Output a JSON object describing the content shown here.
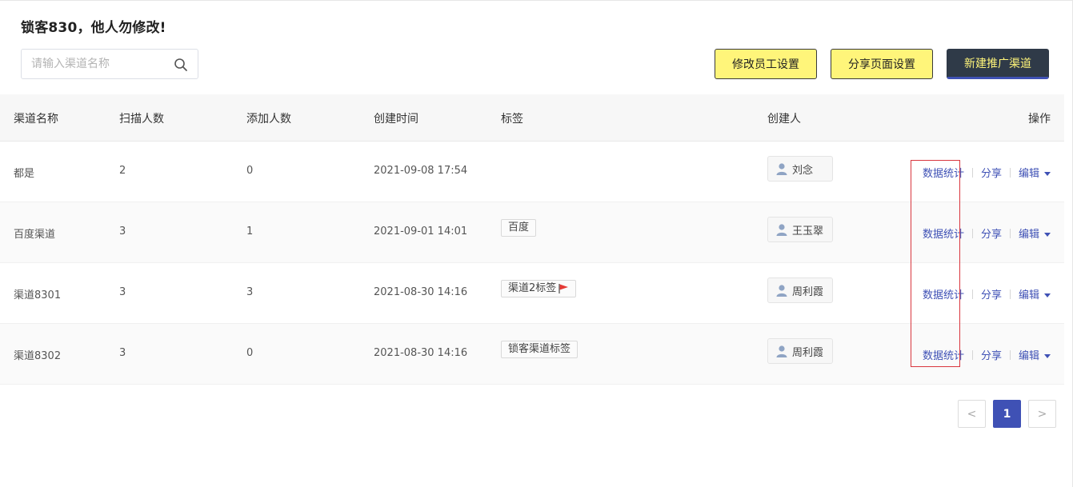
{
  "header": {
    "title": "锁客830，他人勿修改!",
    "search_placeholder": "请输入渠道名称",
    "buttons": {
      "staff_settings": "修改员工设置",
      "share_settings": "分享页面设置",
      "new_channel": "新建推广渠道"
    }
  },
  "table": {
    "columns": {
      "name": "渠道名称",
      "scan": "扫描人数",
      "add": "添加人数",
      "time": "创建时间",
      "tag": "标签",
      "creator": "创建人",
      "ops": "操作"
    },
    "ops_labels": {
      "stats": "数据统计",
      "share": "分享",
      "edit": "编辑"
    },
    "rows": [
      {
        "name": "都是",
        "scan": "2",
        "add": "0",
        "time": "2021-09-08 17:54",
        "tag": "",
        "creator": "刘念"
      },
      {
        "name": "百度渠道",
        "scan": "3",
        "add": "1",
        "time": "2021-09-01 14:01",
        "tag": "百度",
        "creator": "王玉翠"
      },
      {
        "name": "渠道8301",
        "scan": "3",
        "add": "3",
        "time": "2021-08-30 14:16",
        "tag": "渠道2标签",
        "creator": "周利霞"
      },
      {
        "name": "渠道8302",
        "scan": "3",
        "add": "0",
        "time": "2021-08-30 14:16",
        "tag": "锁客渠道标签",
        "creator": "周利霞"
      }
    ]
  },
  "pagination": {
    "prev": "<",
    "current": "1",
    "next": ">"
  },
  "colors": {
    "accent": "#3f51b5",
    "button_yellow": "#fff57a",
    "button_dark": "#2f3a48",
    "highlight": "#d9363e"
  }
}
